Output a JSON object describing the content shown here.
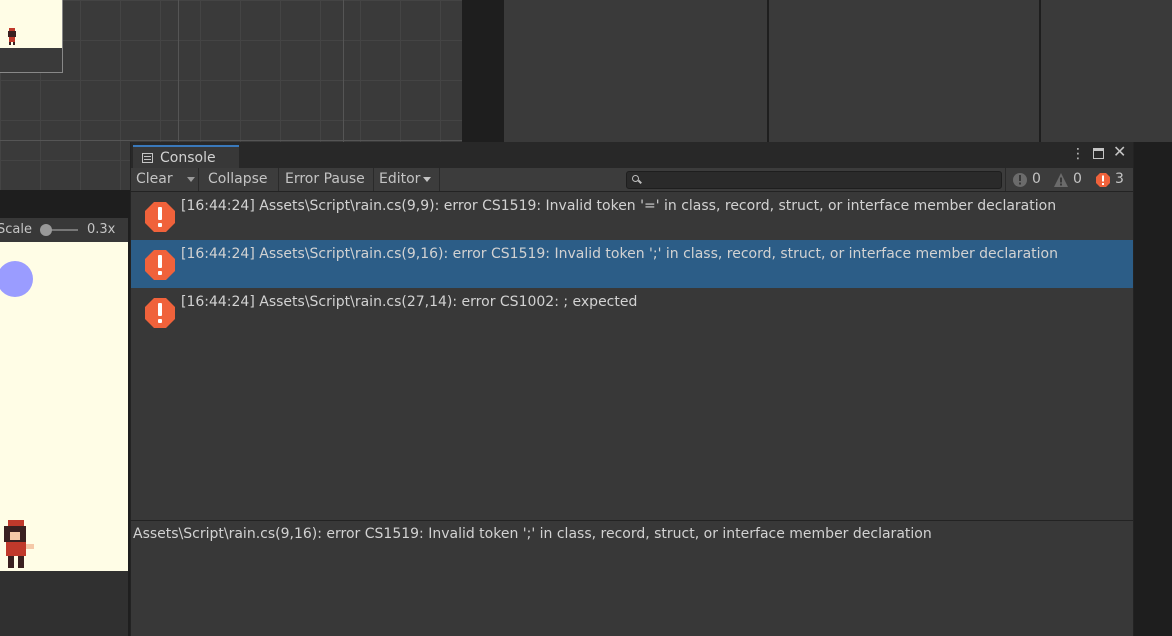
{
  "game": {
    "scale_label": "Scale",
    "scale_value": "0.3x",
    "scale_level": 0.1
  },
  "console": {
    "tab_title": "Console",
    "toolbar": {
      "clear_label": "Clear",
      "collapse_label": "Collapse",
      "error_pause_label": "Error Pause",
      "editor_label": "Editor",
      "search_placeholder": ""
    },
    "counts": {
      "info": "0",
      "warnings": "0",
      "errors": "3"
    },
    "logs": [
      {
        "text": "[16:44:24] Assets\\Script\\rain.cs(9,9): error CS1519: Invalid token '=' in class, record, struct, or interface member declaration",
        "type": "error",
        "selected": false
      },
      {
        "text": "[16:44:24] Assets\\Script\\rain.cs(9,16): error CS1519: Invalid token ';' in class, record, struct, or interface member declaration",
        "type": "error",
        "selected": true
      },
      {
        "text": "[16:44:24] Assets\\Script\\rain.cs(27,14): error CS1002: ; expected",
        "type": "error",
        "selected": false
      }
    ],
    "detail_text": "Assets\\Script\\rain.cs(9,16): error CS1519: Invalid token ';' in class, record, struct, or interface member declaration"
  },
  "colors": {
    "selected_row": "#2c5d87",
    "error_icon": "#f0623b",
    "tab_accent": "#3a79bb"
  }
}
